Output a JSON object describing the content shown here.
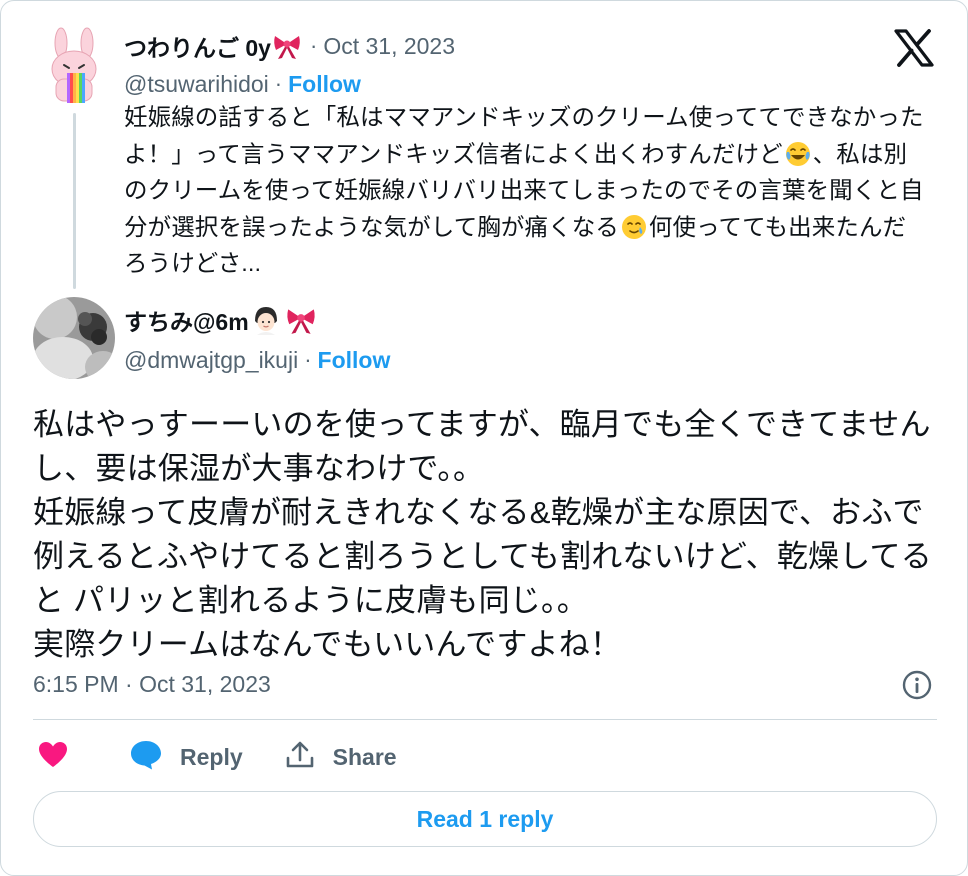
{
  "parent_tweet": {
    "display_name": "つわりんご 0y",
    "name_emoji": "ribbon-emoji",
    "date": "Oct 31, 2023",
    "handle": "@tsuwarihidoi",
    "follow_label": "Follow",
    "text_part1": "妊娠線の話すると「私はママアンドキッズのクリーム使っててできなかったよ！」って言うママアンドキッズ信者によく出くわすんだけど",
    "emoji1": "tears-of-joy-emoji",
    "text_part2": "、私は別のクリームを使って妊娠線バリバリ出来てしまったのでその言葉を聞くと自分が選択を誤ったような気がして胸が痛くなる",
    "emoji2": "smiling-face-with-tear-emoji",
    "text_part3": "何使ってても出来たんだろうけどさ..."
  },
  "main_tweet": {
    "display_name": "すちみ@6m",
    "name_emojis": [
      "baby-emoji",
      "ribbon-emoji"
    ],
    "handle": "@dmwajtgp_ikuji",
    "follow_label": "Follow",
    "text": "私はやっすーーいのを使ってますが、臨月でも全くできてませんし、要は保湿が大事なわけで。。\n妊娠線って皮膚が耐えきれなくなる&乾燥が主な原因で、おふで例えるとふやけてると割ろうとしても割れないけど、乾燥してると パリッと割れるように皮膚も同じ。。\n実際クリームはなんでもいいんですよね！",
    "time": "6:15 PM · Oct 31, 2023"
  },
  "actions": {
    "like_icon": "heart-icon",
    "reply_icon": "speech-bubble-icon",
    "reply_label": "Reply",
    "share_icon": "share-icon",
    "share_label": "Share"
  },
  "read_replies_label": "Read 1 reply",
  "colors": {
    "accent": "#1d9bf0",
    "secondary_text": "#536471",
    "like": "#f91880",
    "border": "#cfd9de"
  }
}
